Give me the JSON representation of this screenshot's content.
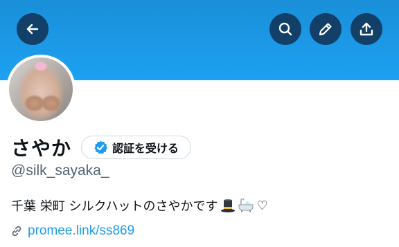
{
  "profile": {
    "display_name": "さやか",
    "handle": "@silk_sayaka_",
    "verify_label": "認証を受ける",
    "bio_text": "千葉 栄町 シルクハットのさやかです",
    "bio_heart": "♡",
    "link": "promee.link/ss869"
  },
  "icons": {
    "back": "arrow-left-icon",
    "search": "search-icon",
    "edit": "pencil-icon",
    "share": "share-icon",
    "verified": "verified-badge-icon",
    "link": "link-icon",
    "emoji_hat": "top-hat-emoji",
    "emoji_bath": "bathtub-emoji"
  },
  "colors": {
    "banner": "#1da1f2",
    "link": "#1d9bf0",
    "handle": "#536471",
    "button_bg": "#14304a"
  }
}
